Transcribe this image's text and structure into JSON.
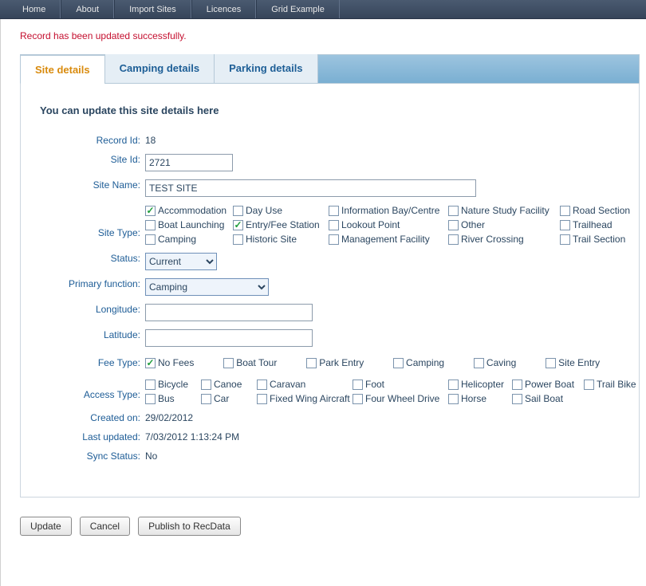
{
  "nav": {
    "home": "Home",
    "about": "About",
    "import": "Import Sites",
    "licences": "Licences",
    "grid": "Grid Example"
  },
  "flash_message": "Record has been updated successfully.",
  "tabs": {
    "site_details": "Site details",
    "camping_details": "Camping details",
    "parking_details": "Parking details"
  },
  "intro": "You can update this site details here",
  "labels": {
    "record_id": "Record Id:",
    "site_id": "Site Id:",
    "site_name": "Site Name:",
    "site_type": "Site Type:",
    "status": "Status:",
    "primary_function": "Primary function:",
    "longitude": "Longitude:",
    "latitude": "Latitude:",
    "fee_type": "Fee Type:",
    "access_type": "Access Type:",
    "created_on": "Created on:",
    "last_updated": "Last updated:",
    "sync_status": "Sync Status:"
  },
  "values": {
    "record_id": "18",
    "site_id": "2721",
    "site_name": "TEST SITE",
    "status": "Current",
    "primary_function": "Camping",
    "longitude": "",
    "latitude": "",
    "created_on": "29/02/2012",
    "last_updated": "7/03/2012 1:13:24 PM",
    "sync_status": "No"
  },
  "site_type_options": [
    {
      "label": "Accommodation",
      "checked": true
    },
    {
      "label": "Day Use",
      "checked": false
    },
    {
      "label": "Information Bay/Centre",
      "checked": false
    },
    {
      "label": "Nature Study Facility",
      "checked": false
    },
    {
      "label": "Road Section",
      "checked": false
    },
    {
      "label": "Boat Launching",
      "checked": false
    },
    {
      "label": "Entry/Fee Station",
      "checked": true
    },
    {
      "label": "Lookout Point",
      "checked": false
    },
    {
      "label": "Other",
      "checked": false
    },
    {
      "label": "Trailhead",
      "checked": false
    },
    {
      "label": "Camping",
      "checked": false
    },
    {
      "label": "Historic Site",
      "checked": false
    },
    {
      "label": "Management Facility",
      "checked": false
    },
    {
      "label": "River Crossing",
      "checked": false
    },
    {
      "label": "Trail Section",
      "checked": false
    }
  ],
  "fee_type_options": [
    {
      "label": "No Fees",
      "checked": true
    },
    {
      "label": "Boat Tour",
      "checked": false
    },
    {
      "label": "Park Entry",
      "checked": false
    },
    {
      "label": "Camping",
      "checked": false
    },
    {
      "label": "Caving",
      "checked": false
    },
    {
      "label": "Site Entry",
      "checked": false
    }
  ],
  "access_type_options_row1": [
    {
      "label": "Bicycle",
      "checked": false
    },
    {
      "label": "Canoe",
      "checked": false
    },
    {
      "label": "Caravan",
      "checked": false
    },
    {
      "label": "Foot",
      "checked": false
    },
    {
      "label": "Helicopter",
      "checked": false
    },
    {
      "label": "Power Boat",
      "checked": false
    },
    {
      "label": "Trail Bike",
      "checked": false
    }
  ],
  "access_type_options_row2": [
    {
      "label": "Bus",
      "checked": false
    },
    {
      "label": "Car",
      "checked": false
    },
    {
      "label": "Fixed Wing Aircraft",
      "checked": false
    },
    {
      "label": "Four Wheel Drive",
      "checked": false
    },
    {
      "label": "Horse",
      "checked": false
    },
    {
      "label": "Sail Boat",
      "checked": false
    }
  ],
  "buttons": {
    "update": "Update",
    "cancel": "Cancel",
    "publish": "Publish to RecData"
  }
}
